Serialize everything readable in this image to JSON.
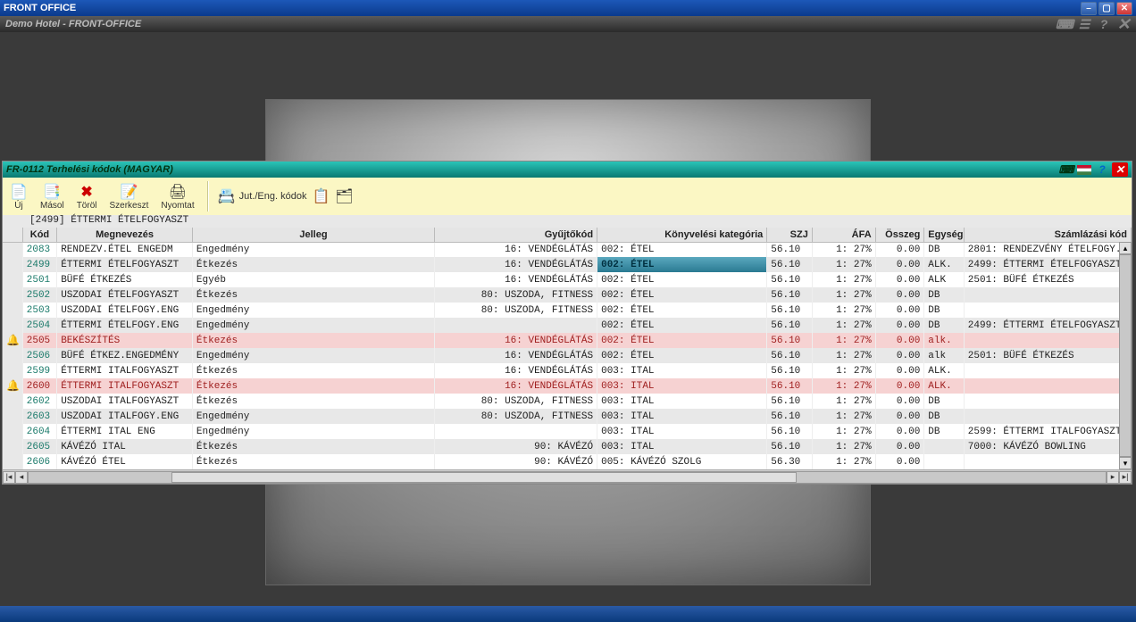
{
  "outer": {
    "title": "FRONT OFFICE",
    "subtitle": "Demo Hotel - FRONT-OFFICE"
  },
  "subwin": {
    "title": "FR-0112 Terhelési kódok (MAGYAR)"
  },
  "toolbar": {
    "uj": "Új",
    "masol": "Másol",
    "torol": "Töröl",
    "szerkeszt": "Szerkeszt",
    "nyomtat": "Nyomtat",
    "juteng": "Jut./Eng. kódok"
  },
  "path": "[2499] ÉTTERMI ÉTELFOGYASZT",
  "columns": {
    "kod": "Kód",
    "megnevezes": "Megnevezés",
    "jelleg": "Jelleg",
    "gyujtokod": "Gyűjtőkód",
    "konyvelesi": "Könyvelési kategória",
    "szj": "SZJ",
    "afa": "ÁFA",
    "osszeg": "Összeg",
    "egyseg": "Egység",
    "szamlazasi": "Számlázási kód"
  },
  "rows": [
    {
      "kod": "2083",
      "megnevezes": "RENDEZV.ÉTEL ENGEDM",
      "jelleg": "Engedmény",
      "gyujtokod": "16: VENDÉGLÁTÁS",
      "konyvelesi": "002: ÉTEL",
      "szj": "56.10",
      "afa": "1: 27%",
      "osszeg": "0.00",
      "egyseg": "DB",
      "szamlazasi": "2801: RENDEZVÉNY ÉTELFOGY."
    },
    {
      "kod": "2499",
      "megnevezes": "ÉTTERMI ÉTELFOGYASZT",
      "jelleg": "Étkezés",
      "gyujtokod": "16: VENDÉGLÁTÁS",
      "konyvelesi": "002: ÉTEL",
      "szj": "56.10",
      "afa": "1: 27%",
      "osszeg": "0.00",
      "egyseg": "ALK.",
      "szamlazasi": "2499: ÉTTERMI ÉTELFOGYASZT",
      "selected": true
    },
    {
      "kod": "2501",
      "megnevezes": "BÜFÉ ÉTKEZÉS",
      "jelleg": "Egyéb",
      "gyujtokod": "16: VENDÉGLÁTÁS",
      "konyvelesi": "002: ÉTEL",
      "szj": "56.10",
      "afa": "1: 27%",
      "osszeg": "0.00",
      "egyseg": "ALK",
      "szamlazasi": "2501: BÜFÉ ÉTKEZÉS"
    },
    {
      "kod": "2502",
      "megnevezes": "USZODAI ÉTELFOGYASZT",
      "jelleg": "Étkezés",
      "gyujtokod": "80: USZODA, FITNESS",
      "konyvelesi": "002: ÉTEL",
      "szj": "56.10",
      "afa": "1: 27%",
      "osszeg": "0.00",
      "egyseg": "DB",
      "szamlazasi": ""
    },
    {
      "kod": "2503",
      "megnevezes": "USZODAI ÉTELFOGY.ENG",
      "jelleg": "Engedmény",
      "gyujtokod": "80: USZODA, FITNESS",
      "konyvelesi": "002: ÉTEL",
      "szj": "56.10",
      "afa": "1: 27%",
      "osszeg": "0.00",
      "egyseg": "DB",
      "szamlazasi": ""
    },
    {
      "kod": "2504",
      "megnevezes": "ÉTTERMI ÉTELFOGY.ENG",
      "jelleg": "Engedmény",
      "gyujtokod": "",
      "konyvelesi": "002: ÉTEL",
      "szj": "56.10",
      "afa": "1: 27%",
      "osszeg": "0.00",
      "egyseg": "DB",
      "szamlazasi": "2499: ÉTTERMI ÉTELFOGYASZT"
    },
    {
      "kod": "2505",
      "megnevezes": "BEKÉSZÍTÉS",
      "jelleg": "Étkezés",
      "gyujtokod": "16: VENDÉGLÁTÁS",
      "konyvelesi": "002: ÉTEL",
      "szj": "56.10",
      "afa": "1: 27%",
      "osszeg": "0.00",
      "egyseg": "alk.",
      "szamlazasi": "",
      "hl": true,
      "icon": true
    },
    {
      "kod": "2506",
      "megnevezes": "BÜFÉ ÉTKEZ.ENGEDMÉNY",
      "jelleg": "Engedmény",
      "gyujtokod": "16: VENDÉGLÁTÁS",
      "konyvelesi": "002: ÉTEL",
      "szj": "56.10",
      "afa": "1: 27%",
      "osszeg": "0.00",
      "egyseg": "alk",
      "szamlazasi": "2501: BÜFÉ ÉTKEZÉS"
    },
    {
      "kod": "2599",
      "megnevezes": "ÉTTERMI ITALFOGYASZT",
      "jelleg": "Étkezés",
      "gyujtokod": "16: VENDÉGLÁTÁS",
      "konyvelesi": "003: ITAL",
      "szj": "56.10",
      "afa": "1: 27%",
      "osszeg": "0.00",
      "egyseg": "ALK.",
      "szamlazasi": ""
    },
    {
      "kod": "2600",
      "megnevezes": "ÉTTERMI ITALFOGYASZT",
      "jelleg": "Étkezés",
      "gyujtokod": "16: VENDÉGLÁTÁS",
      "konyvelesi": "003: ITAL",
      "szj": "56.10",
      "afa": "1: 27%",
      "osszeg": "0.00",
      "egyseg": "ALK.",
      "szamlazasi": "",
      "hl": true,
      "icon": true
    },
    {
      "kod": "2602",
      "megnevezes": "USZODAI ITALFOGYASZT",
      "jelleg": "Étkezés",
      "gyujtokod": "80: USZODA, FITNESS",
      "konyvelesi": "003: ITAL",
      "szj": "56.10",
      "afa": "1: 27%",
      "osszeg": "0.00",
      "egyseg": "DB",
      "szamlazasi": ""
    },
    {
      "kod": "2603",
      "megnevezes": "USZODAI ITALFOGY.ENG",
      "jelleg": "Engedmény",
      "gyujtokod": "80: USZODA, FITNESS",
      "konyvelesi": "003: ITAL",
      "szj": "56.10",
      "afa": "1: 27%",
      "osszeg": "0.00",
      "egyseg": "DB",
      "szamlazasi": ""
    },
    {
      "kod": "2604",
      "megnevezes": "ÉTTERMI ITAL ENG",
      "jelleg": "Engedmény",
      "gyujtokod": "",
      "konyvelesi": "003: ITAL",
      "szj": "56.10",
      "afa": "1: 27%",
      "osszeg": "0.00",
      "egyseg": "DB",
      "szamlazasi": "2599: ÉTTERMI ITALFOGYASZT"
    },
    {
      "kod": "2605",
      "megnevezes": "KÁVÉZÓ ITAL",
      "jelleg": "Étkezés",
      "gyujtokod": "90: KÁVÉZÓ",
      "konyvelesi": "003: ITAL",
      "szj": "56.10",
      "afa": "1: 27%",
      "osszeg": "0.00",
      "egyseg": "",
      "szamlazasi": "7000: KÁVÉZÓ BOWLING"
    },
    {
      "kod": "2606",
      "megnevezes": "KÁVÉZÓ ÉTEL",
      "jelleg": "Étkezés",
      "gyujtokod": "90: KÁVÉZÓ",
      "konyvelesi": "005: KÁVÉZÓ SZOLG",
      "szj": "56.30",
      "afa": "1: 27%",
      "osszeg": "0.00",
      "egyseg": "",
      "szamlazasi": ""
    }
  ]
}
